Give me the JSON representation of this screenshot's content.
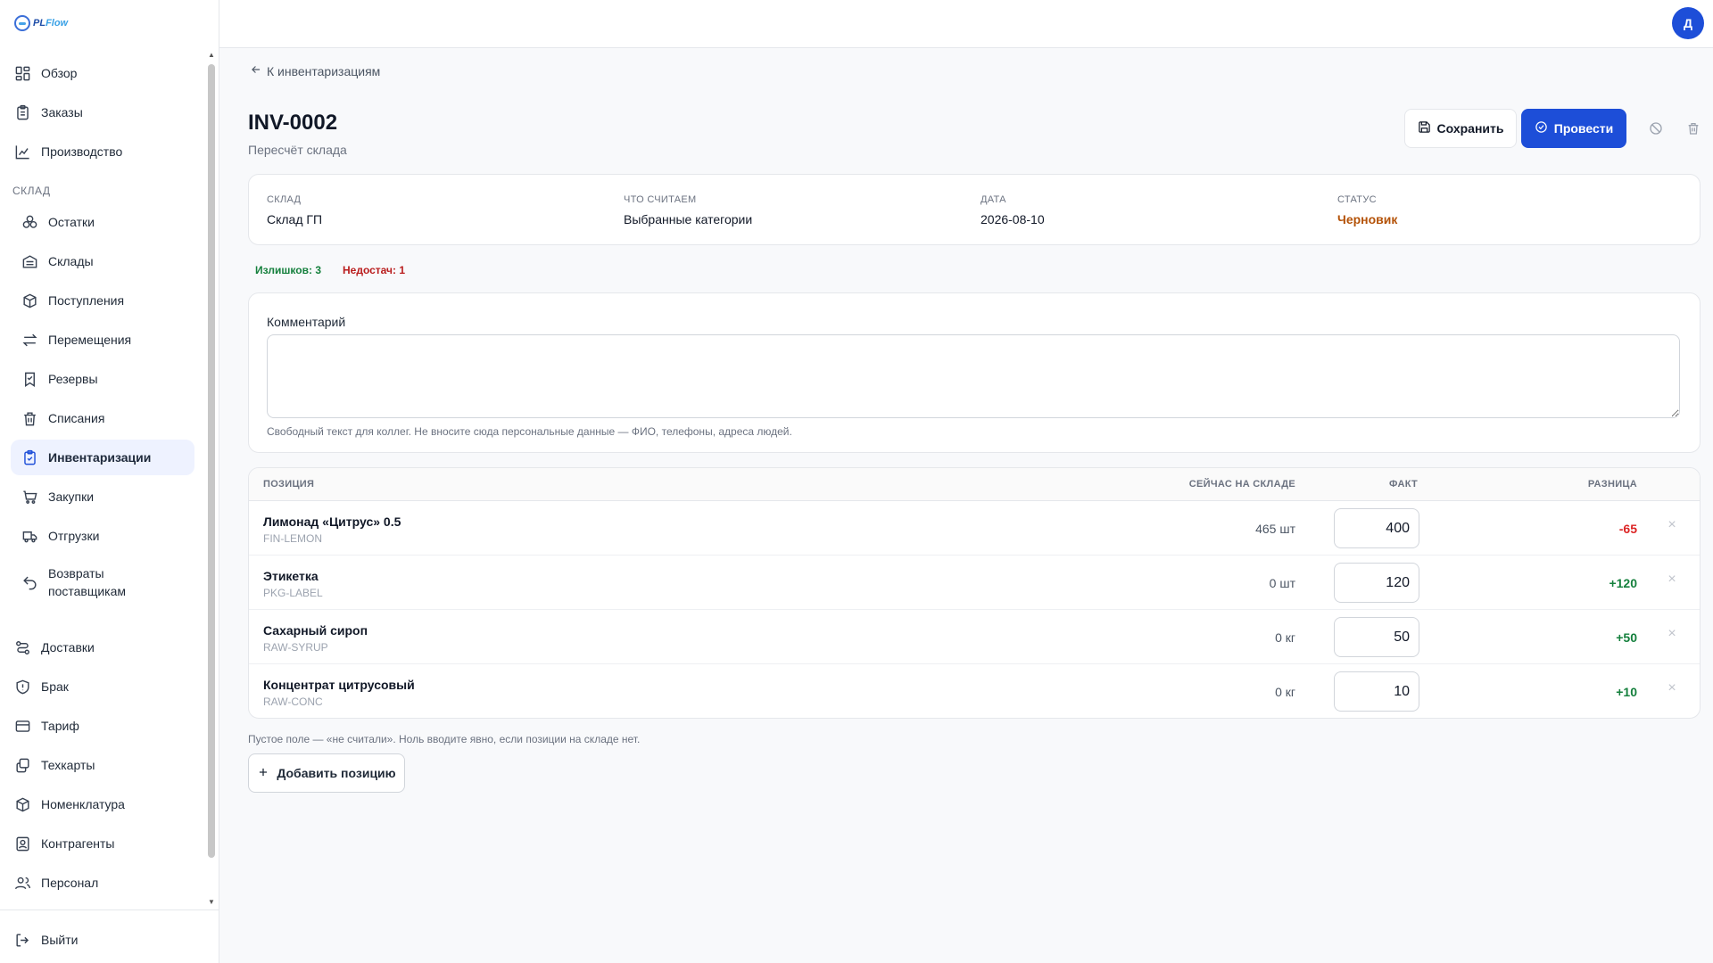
{
  "app": {
    "logo_text_main": "PL",
    "logo_text_accent": "Flow"
  },
  "user": {
    "avatar_initial": "Д"
  },
  "sidebar": {
    "top_items": [
      {
        "label": "Обзор",
        "icon": "grid-icon"
      },
      {
        "label": "Заказы",
        "icon": "clipboard-icon"
      },
      {
        "label": "Производство",
        "icon": "chart-icon"
      }
    ],
    "section_title": "СКЛАД",
    "warehouse_items": [
      {
        "label": "Остатки",
        "icon": "boxes-icon"
      },
      {
        "label": "Склады",
        "icon": "warehouse-icon"
      },
      {
        "label": "Поступления",
        "icon": "package-in-icon"
      },
      {
        "label": "Перемещения",
        "icon": "transfer-icon"
      },
      {
        "label": "Резервы",
        "icon": "bookmark-icon"
      },
      {
        "label": "Списания",
        "icon": "trash-icon"
      },
      {
        "label": "Инвентаризации",
        "icon": "clipboard-check-icon",
        "active": true
      },
      {
        "label": "Закупки",
        "icon": "cart-icon"
      },
      {
        "label": "Отгрузки",
        "icon": "truck-icon"
      },
      {
        "label": "Возвраты поставщикам",
        "icon": "undo-icon"
      }
    ],
    "bottom_items": [
      {
        "label": "Доставки",
        "icon": "route-icon"
      },
      {
        "label": "Брак",
        "icon": "shield-alert-icon"
      },
      {
        "label": "Тариф",
        "icon": "card-icon"
      },
      {
        "label": "Техкарты",
        "icon": "layers-icon"
      },
      {
        "label": "Номенклатура",
        "icon": "cube-icon"
      },
      {
        "label": "Контрагенты",
        "icon": "contact-icon"
      },
      {
        "label": "Персонал",
        "icon": "users-icon"
      }
    ],
    "logout_label": "Выйти"
  },
  "page": {
    "back_link": "К инвентаризациям",
    "title": "INV-0002",
    "subtitle": "Пересчёт склада",
    "save_label": "Сохранить",
    "post_label": "Провести"
  },
  "info": {
    "warehouse_label": "СКЛАД",
    "warehouse_value": "Склад ГП",
    "scope_label": "ЧТО СЧИТАЕМ",
    "scope_value": "Выбранные категории",
    "date_label": "ДАТА",
    "date_value": "2026-08-10",
    "status_label": "СТАТУС",
    "status_value": "Черновик",
    "status_color": "#b45309"
  },
  "stats": {
    "surplus": "Излишков: 3",
    "shortage": "Недостач: 1"
  },
  "comment": {
    "label": "Комментарий",
    "value": "",
    "help": "Свободный текст для коллег. Не вносите сюда персональные данные — ФИО, телефоны, адреса людей."
  },
  "table": {
    "headers": {
      "position": "ПОЗИЦИЯ",
      "stock": "СЕЙЧАС НА СКЛАДЕ",
      "fact": "ФАКТ",
      "diff": "РАЗНИЦА"
    },
    "rows": [
      {
        "name": "Лимонад «Цитрус» 0.5",
        "sku": "FIN-LEMON",
        "stock": "465 шт",
        "fact": "400",
        "diff": "-65",
        "diff_sign": "neg"
      },
      {
        "name": "Этикетка",
        "sku": "PKG-LABEL",
        "stock": "0 шт",
        "fact": "120",
        "diff": "+120",
        "diff_sign": "pos"
      },
      {
        "name": "Сахарный сироп",
        "sku": "RAW-SYRUP",
        "stock": "0 кг",
        "fact": "50",
        "diff": "+50",
        "diff_sign": "pos"
      },
      {
        "name": "Концентрат цитрусовый",
        "sku": "RAW-CONC",
        "stock": "0 кг",
        "fact": "10",
        "diff": "+10",
        "diff_sign": "pos"
      }
    ],
    "help": "Пустое поле — «не считали». Ноль вводите явно, если позиции на складе нет.",
    "add_label": "Добавить позицию"
  },
  "colors": {
    "accent": "#1d4ed8",
    "positive": "#15803d",
    "negative": "#dc2626"
  }
}
